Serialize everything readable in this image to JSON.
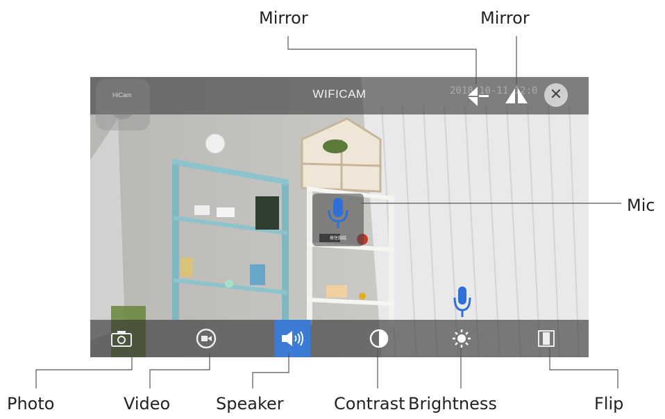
{
  "callouts": {
    "mirror_left": "Mirror",
    "mirror_right": "Mirror",
    "mic": "Mic",
    "photo": "Photo",
    "video": "Video",
    "speaker": "Speaker",
    "contrast": "Contrast",
    "brightness": "Brightness",
    "flip": "Flip"
  },
  "camera": {
    "title": "WIFICAM",
    "timestamp": "2018-10-11 12:0",
    "logo_text": "HiCam",
    "mic_caption": "按住說話"
  },
  "toolbar_top": {
    "icons": [
      "mirror-horizontal-icon",
      "mirror-vertical-icon",
      "close-icon"
    ],
    "close_glyph": "✕"
  },
  "toolbar_bottom": {
    "icons": [
      "camera-icon",
      "video-record-icon",
      "speaker-icon",
      "contrast-icon",
      "brightness-icon",
      "flip-icon"
    ],
    "active": "speaker-icon"
  },
  "colors": {
    "accent": "#3b7bd6",
    "mic_blue": "#2f6fd8",
    "bar_bg": "#3c3c3e"
  }
}
